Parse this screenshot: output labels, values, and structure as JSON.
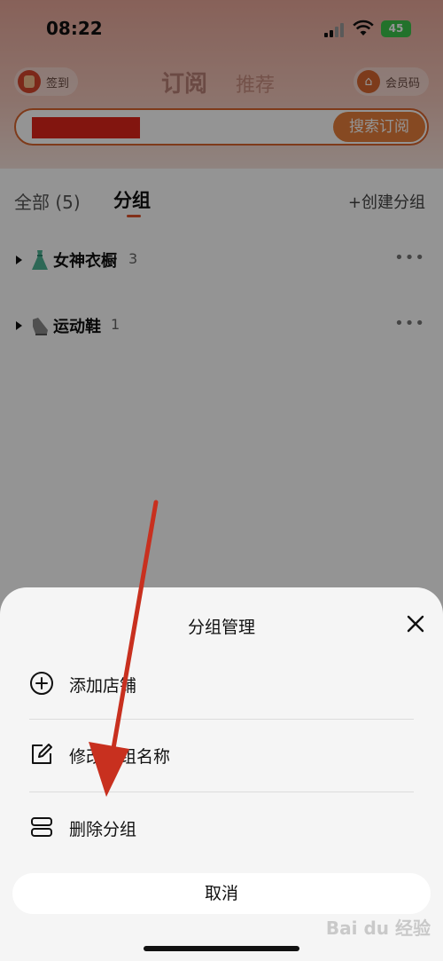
{
  "status_bar": {
    "time": "08:22",
    "battery": "45"
  },
  "nav": {
    "signin_label": "签到",
    "tab_subscribe": "订阅",
    "tab_recommend": "推荐",
    "member_label": "会员码"
  },
  "search": {
    "button_label": "搜索订阅"
  },
  "tabs": {
    "all_label": "全部 (5)",
    "group_label": "分组",
    "create_group": "+创建分组"
  },
  "groups": [
    {
      "name": "女神衣橱",
      "count": "3",
      "more": "•••",
      "icon": "dress-icon"
    },
    {
      "name": "运动鞋",
      "count": "1",
      "more": "•••",
      "icon": "sneaker-icon"
    }
  ],
  "sheet": {
    "title": "分组管理",
    "items": [
      {
        "label": "添加店铺",
        "icon": "plus-circle-icon"
      },
      {
        "label": "修改分组名称",
        "icon": "edit-icon"
      },
      {
        "label": "删除分组",
        "icon": "delete-group-icon"
      }
    ],
    "cancel_label": "取消"
  },
  "watermark": "Bai du 经验",
  "colors": {
    "accent": "#e77f3b",
    "redaction": "#e1251b",
    "annotation_arrow": "#c8301f"
  }
}
